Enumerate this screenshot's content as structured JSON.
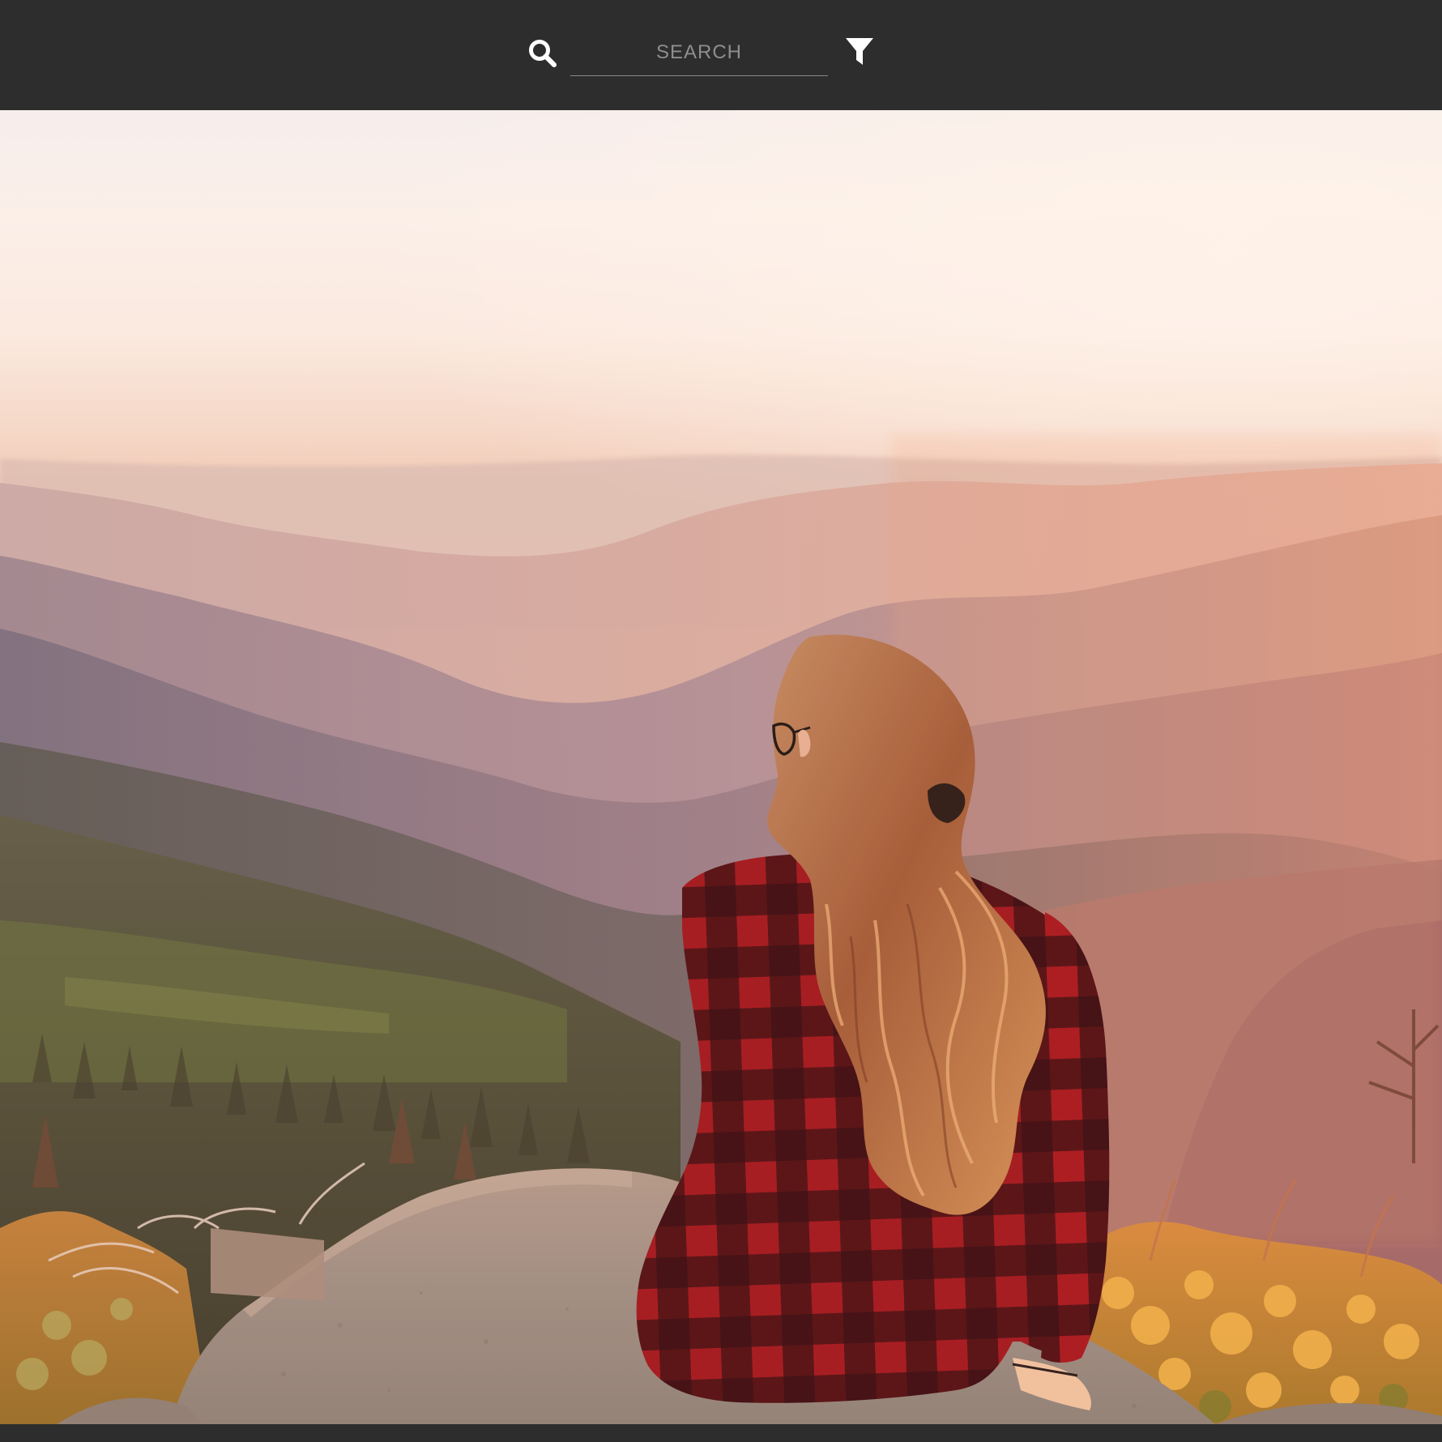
{
  "topbar": {
    "search": {
      "icon": "search-icon",
      "placeholder": "SEARCH",
      "value": ""
    },
    "filter": {
      "icon": "filter-icon"
    }
  },
  "feed": {
    "photo": {
      "subject": "photo-woman-overlooking-mountains"
    }
  },
  "colors": {
    "bar": "#2d2d2e",
    "icon": "#ffffff",
    "placeholder": "#8e8e8e",
    "underline": "#8a8a8a"
  }
}
